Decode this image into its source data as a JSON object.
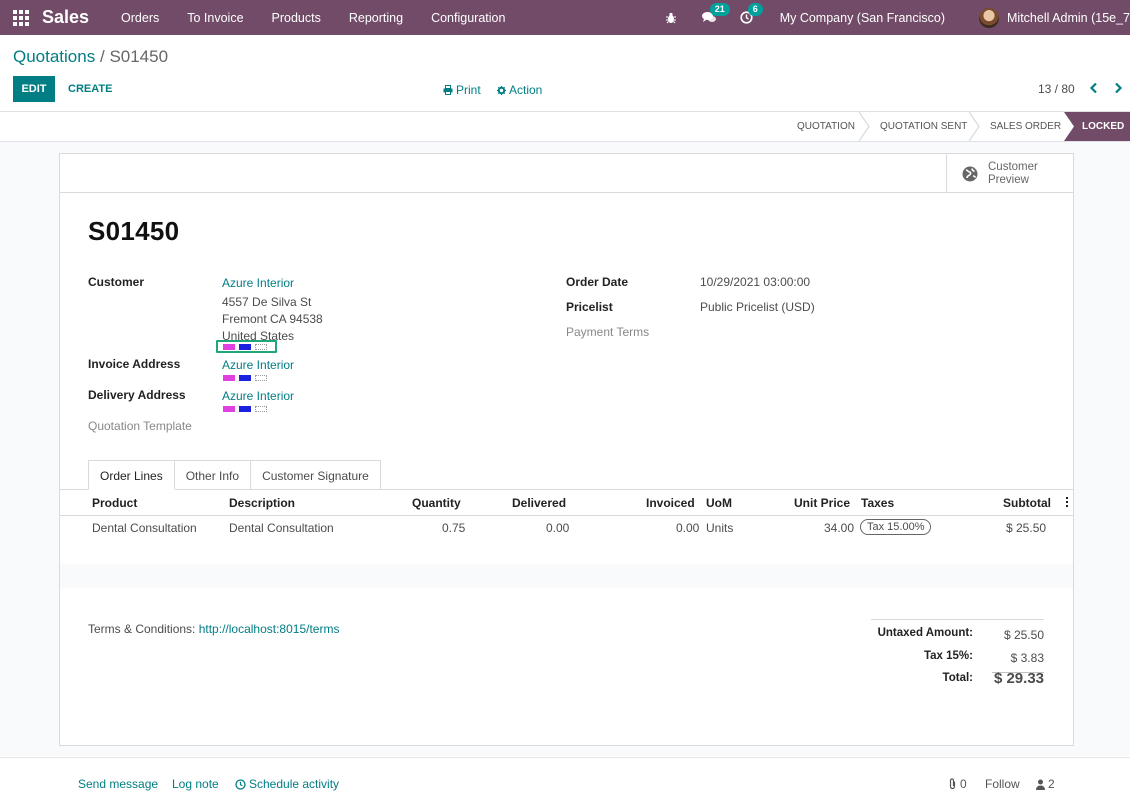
{
  "navbar": {
    "app_name": "Sales",
    "menu": [
      "Orders",
      "To Invoice",
      "Products",
      "Reporting",
      "Configuration"
    ],
    "messages_count": "21",
    "activities_count": "6",
    "company": "My Company (San Francisco)",
    "user": "Mitchell Admin (15e_7"
  },
  "breadcrumb": {
    "parent": "Quotations",
    "separator": "/",
    "current": "S01450"
  },
  "control_panel": {
    "edit_label": "EDIT",
    "create_label": "CREATE",
    "print_label": "Print",
    "action_label": "Action",
    "pager": "13 / 80"
  },
  "status_stages": {
    "quotation": "QUOTATION",
    "quotation_sent": "QUOTATION SENT",
    "sales_order": "SALES ORDER",
    "locked": "LOCKED"
  },
  "smart_button": {
    "label_line1": "Customer",
    "label_line2": "Preview"
  },
  "order": {
    "name": "S01450",
    "customer_label": "Customer",
    "customer_name": "Azure Interior",
    "address_line1": "4557 De Silva St",
    "address_line2": "Fremont CA 94538",
    "address_line3": "United States",
    "invoice_address_label": "Invoice Address",
    "invoice_address": "Azure Interior",
    "delivery_address_label": "Delivery Address",
    "delivery_address": "Azure Interior",
    "quotation_template_label": "Quotation Template",
    "order_date_label": "Order Date",
    "order_date": "10/29/2021 03:00:00",
    "pricelist_label": "Pricelist",
    "pricelist": "Public Pricelist (USD)",
    "payment_terms_label": "Payment Terms",
    "tag_colors": [
      "#e040e0",
      "#1a22e0",
      "#ffffff"
    ]
  },
  "tabs": [
    "Order Lines",
    "Other Info",
    "Customer Signature"
  ],
  "table": {
    "headers": {
      "product": "Product",
      "description": "Description",
      "quantity": "Quantity",
      "delivered": "Delivered",
      "invoiced": "Invoiced",
      "uom": "UoM",
      "unit_price": "Unit Price",
      "taxes": "Taxes",
      "subtotal": "Subtotal"
    },
    "rows": [
      {
        "product": "Dental Consultation",
        "description": "Dental Consultation",
        "quantity": "0.75",
        "delivered": "0.00",
        "invoiced": "0.00",
        "uom": "Units",
        "unit_price": "34.00",
        "taxes": "Tax 15.00%",
        "subtotal": "$ 25.50"
      }
    ]
  },
  "terms": {
    "label": "Terms & Conditions:",
    "link": "http://localhost:8015/terms"
  },
  "totals": {
    "untaxed_label": "Untaxed Amount:",
    "untaxed_value": "$ 25.50",
    "tax_label": "Tax 15%:",
    "tax_value": "$ 3.83",
    "total_label": "Total:",
    "total_value": "$ 29.33"
  },
  "chatter": {
    "send_message": "Send message",
    "log_note": "Log note",
    "schedule_activity": "Schedule activity",
    "attachments": "0",
    "follow": "Follow",
    "followers": "2"
  },
  "colors": {
    "brand": "#714b67",
    "accent": "#017e84",
    "badge": "#00a09d"
  }
}
